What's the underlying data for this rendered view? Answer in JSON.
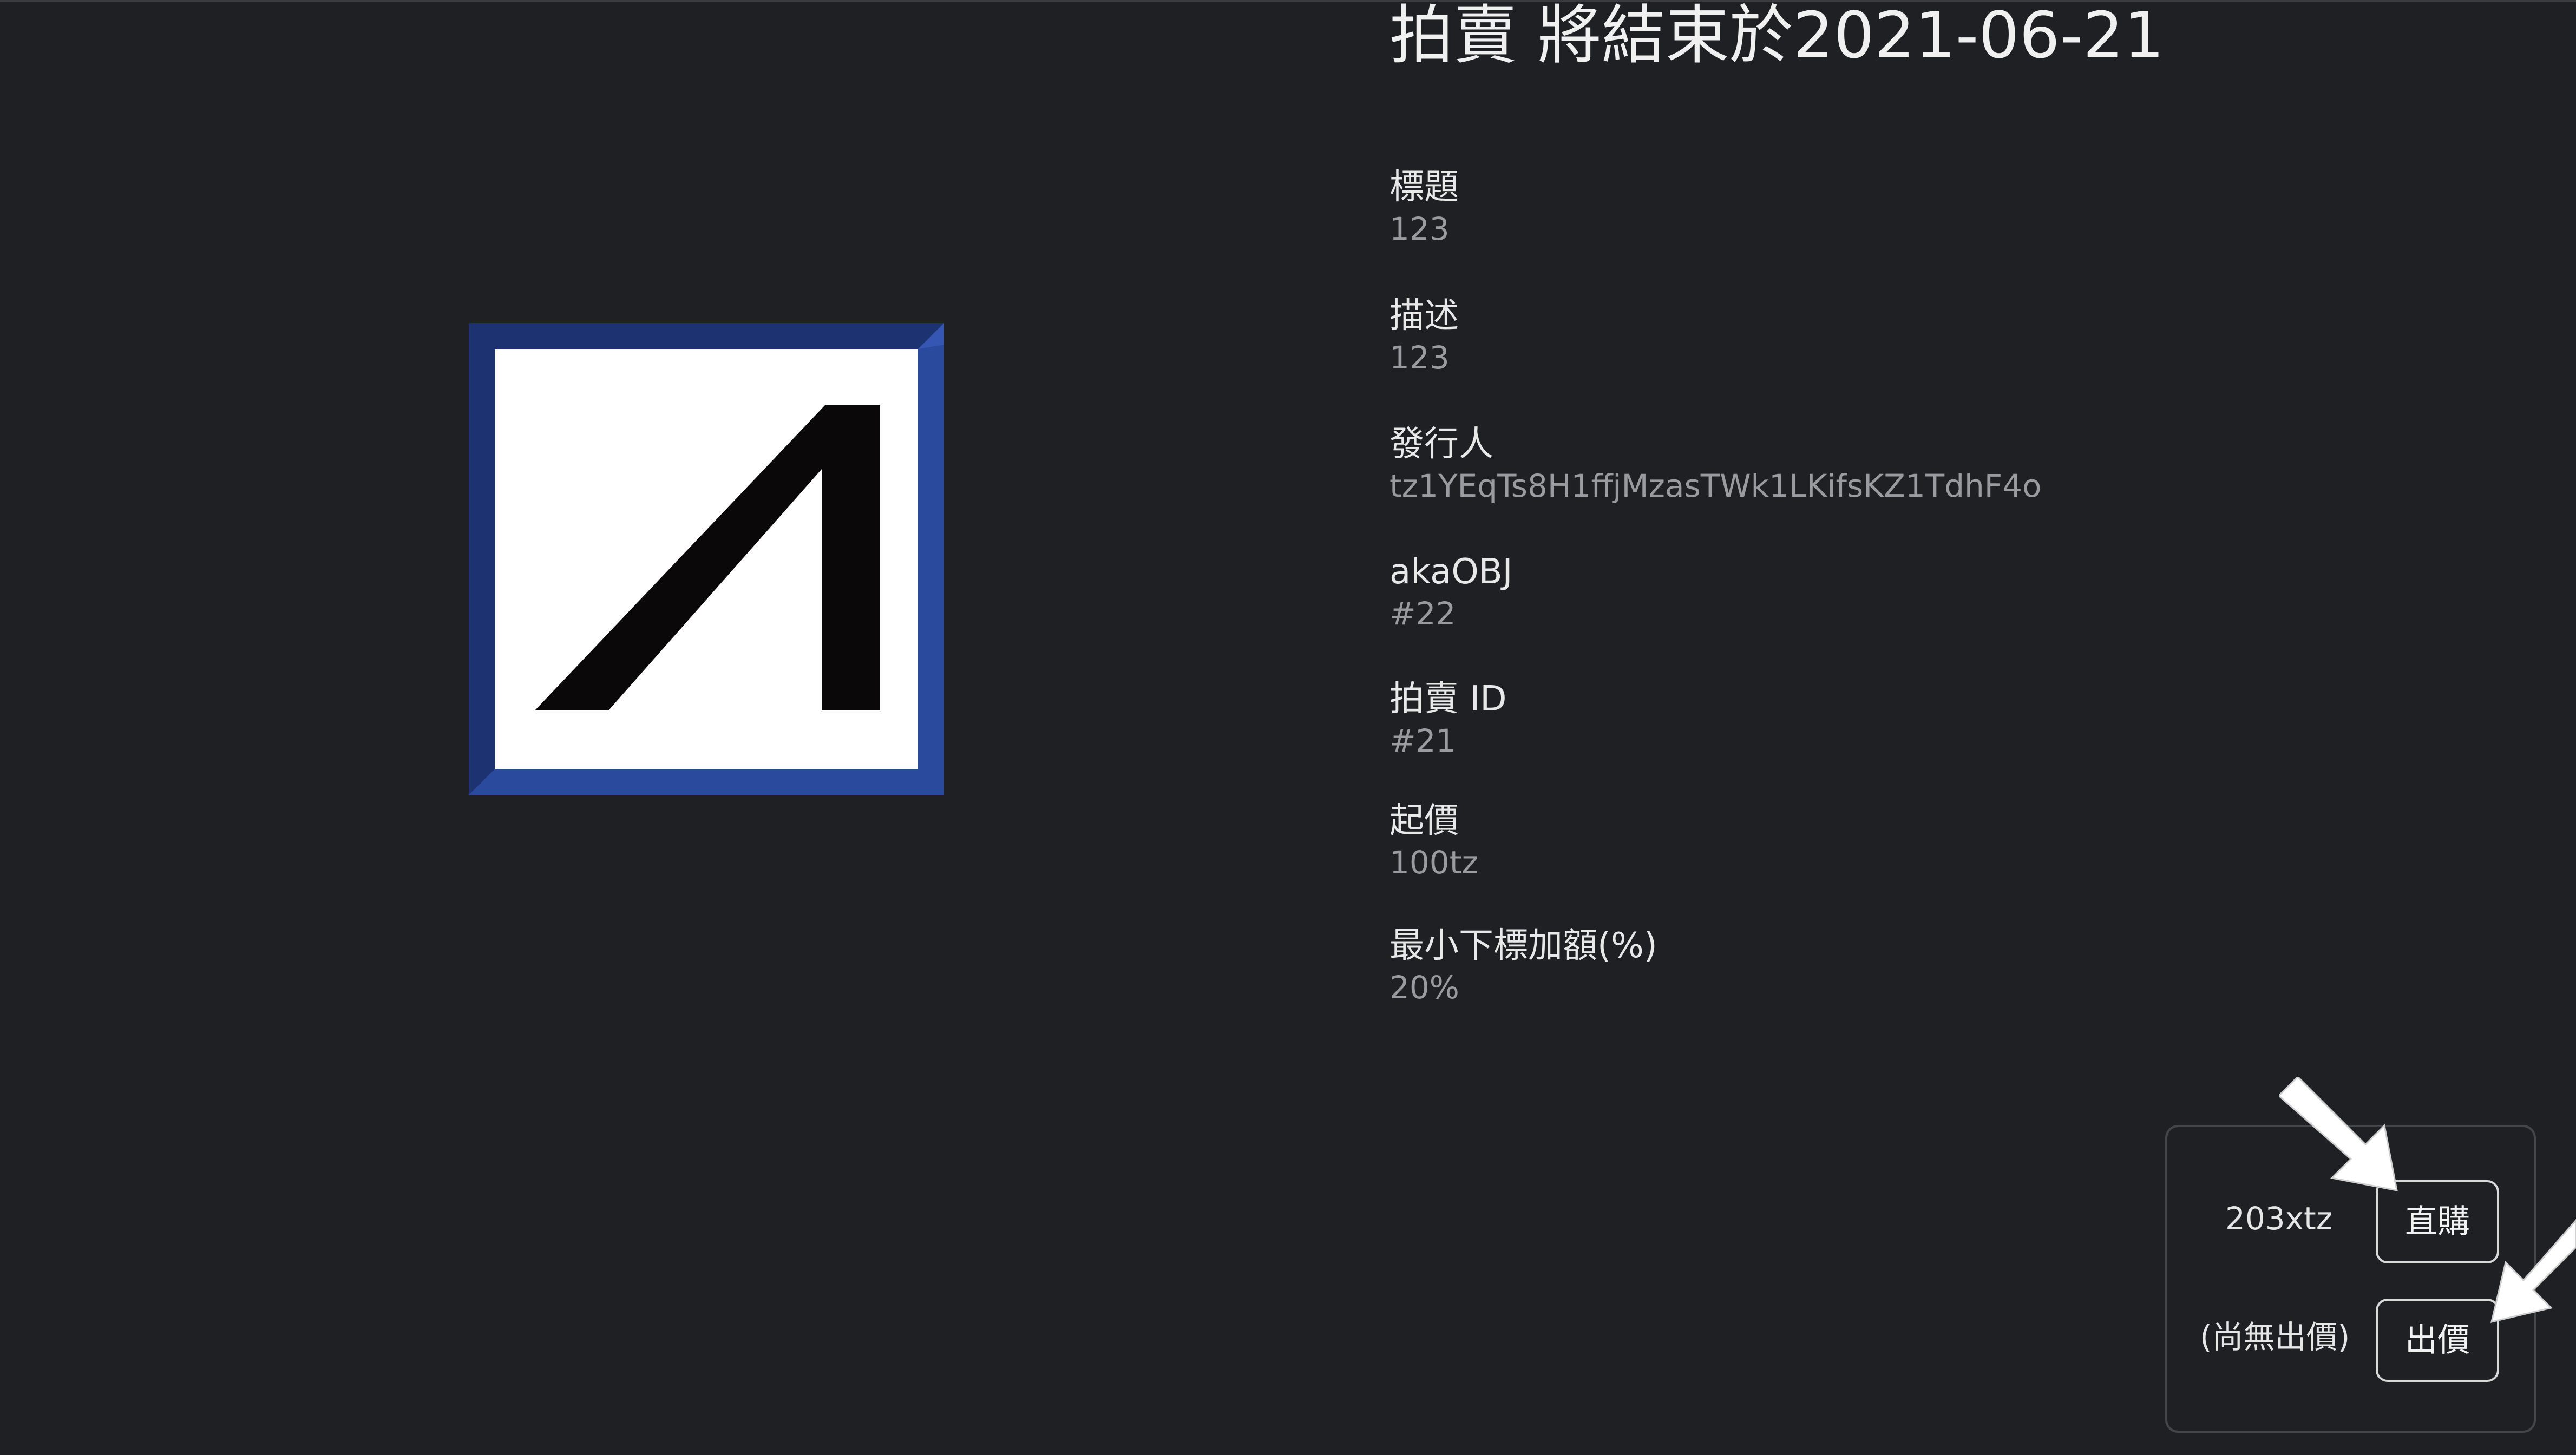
{
  "auction": {
    "heading": "拍賣 將結束於2021-06-21"
  },
  "fields": [
    {
      "label": "標題",
      "value": "123"
    },
    {
      "label": "描述",
      "value": "123"
    },
    {
      "label": "發行人",
      "value": "tz1YEqTs8H1ffjMzasTWk1LKifsKZ1TdhF4o"
    },
    {
      "label": "akaOBJ",
      "value": "#22"
    },
    {
      "label": "拍賣 ID",
      "value": "#21"
    },
    {
      "label": "起價",
      "value": "100tz"
    },
    {
      "label": "最小下標加額(%)",
      "value": "20%"
    }
  ],
  "panel": {
    "buy_now_price": "203xtz",
    "buy_now_label": "直購",
    "current_bid": "(尚無出價)",
    "bid_label": "出價"
  },
  "colors": {
    "background": "#1f2024",
    "artwork_frame": "#2a4a9e",
    "button_border": "#d9d9d9"
  },
  "icons": {
    "arrow_buy": "arrow-pointer-icon",
    "arrow_bid": "arrow-pointer-icon"
  }
}
